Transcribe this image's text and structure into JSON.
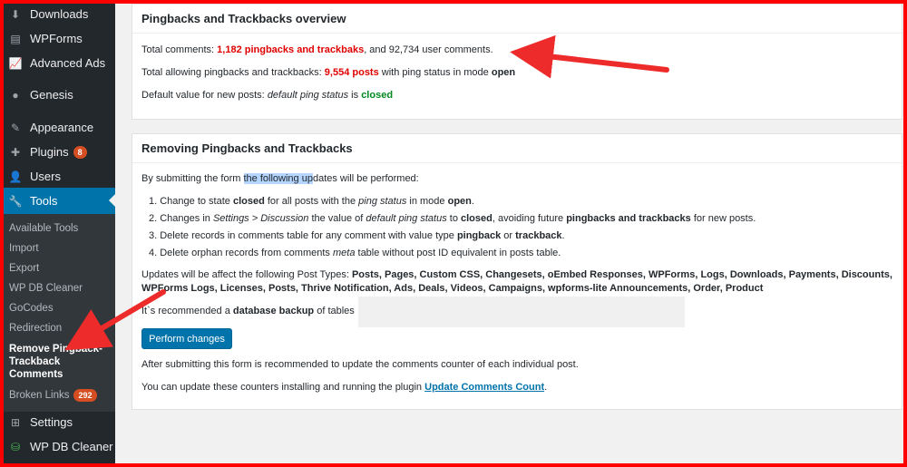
{
  "sidebar": {
    "menu": [
      {
        "label": "Downloads",
        "icon": "download-icon"
      },
      {
        "label": "WPForms",
        "icon": "forms-icon"
      },
      {
        "label": "Advanced Ads",
        "icon": "chart-icon"
      },
      {
        "label": "Genesis",
        "icon": "genesis-icon"
      },
      {
        "label": "Appearance",
        "icon": "brush-icon"
      },
      {
        "label": "Plugins",
        "icon": "plugin-icon",
        "badge": "8"
      },
      {
        "label": "Users",
        "icon": "user-icon"
      },
      {
        "label": "Tools",
        "icon": "wrench-icon"
      },
      {
        "label": "Settings",
        "icon": "settings-icon"
      },
      {
        "label": "WP DB Cleaner",
        "icon": "database-icon"
      }
    ],
    "submenu": [
      {
        "label": "Available Tools"
      },
      {
        "label": "Import"
      },
      {
        "label": "Export"
      },
      {
        "label": "WP DB Cleaner"
      },
      {
        "label": "GoCodes"
      },
      {
        "label": "Redirection"
      },
      {
        "label": "Remove Pingback-Trackback Comments"
      },
      {
        "label": "Broken Links",
        "badge": "292"
      }
    ]
  },
  "overview": {
    "title": "Pingbacks and Trackbacks overview",
    "total_comments_prefix": "Total comments:",
    "pingbacks_count": "1,182 pingbacks and trackbaks",
    "total_comments_suffix": ", and 92,734 user comments.",
    "allowing_prefix": "Total allowing pingbacks and trackbacks:",
    "allowing_posts": "9,554 posts",
    "allowing_mid": "with ping status in mode",
    "allowing_mode": "open",
    "default_prefix": "Default value for new posts:",
    "default_italic": "default ping status",
    "default_is": "is",
    "default_value": "closed"
  },
  "removing": {
    "title": "Removing Pingbacks and Trackbacks",
    "intro_a": "By submitting the form",
    "intro_hl": "the following up",
    "intro_b": "dates will be performed:",
    "steps": [
      {
        "a": "1. Change to state ",
        "b": "closed",
        "c": " for all posts with the ",
        "d": "ping status",
        "e": " in mode ",
        "f": "open",
        "g": "."
      },
      {
        "a": "2. Changes in ",
        "b": "Settings > Discussion",
        "c": " the value of ",
        "d": "default ping status",
        "e": " to ",
        "f": "closed",
        "g": ", avoiding future ",
        "h": "pingbacks and trackbacks",
        "i": " for new posts."
      },
      {
        "a": "3. Delete records in comments table for any comment with value type ",
        "b": "pingback",
        "c": " or ",
        "d": "trackback",
        "e": "."
      },
      {
        "a": "4. Delete orphan records from comments ",
        "b": "meta",
        "c": " table without post ID equivalent in posts table."
      }
    ],
    "post_types_prefix": "Updates will be affect the following Post Types:",
    "post_types_line1": "Posts, Pages, Custom CSS, Changesets, oEmbed Responses, WPForms, Logs, Downloads, Payments, Discounts,",
    "post_types_line2": "WPForms Logs, Licenses, Posts, Thrive Notification, Ads, Deals, Videos, Campaigns, wpforms-lite Announcements, Order, Product",
    "backup_prefix": "It`s recommended a",
    "backup_bold": "database backup",
    "backup_suffix": "of tables",
    "button_label": "Perform changes",
    "after_text": "After submitting this form is recommended to update the comments counter of each individual post.",
    "counters_prefix": "You can update these counters installing and running the plugin",
    "counters_link": "Update Comments Count",
    "counters_suffix": "."
  },
  "colors": {
    "accent": "#0073aa",
    "highlight_red": "#e00000",
    "status_green": "#008a20",
    "annotation_red": "#ee2b2b"
  }
}
